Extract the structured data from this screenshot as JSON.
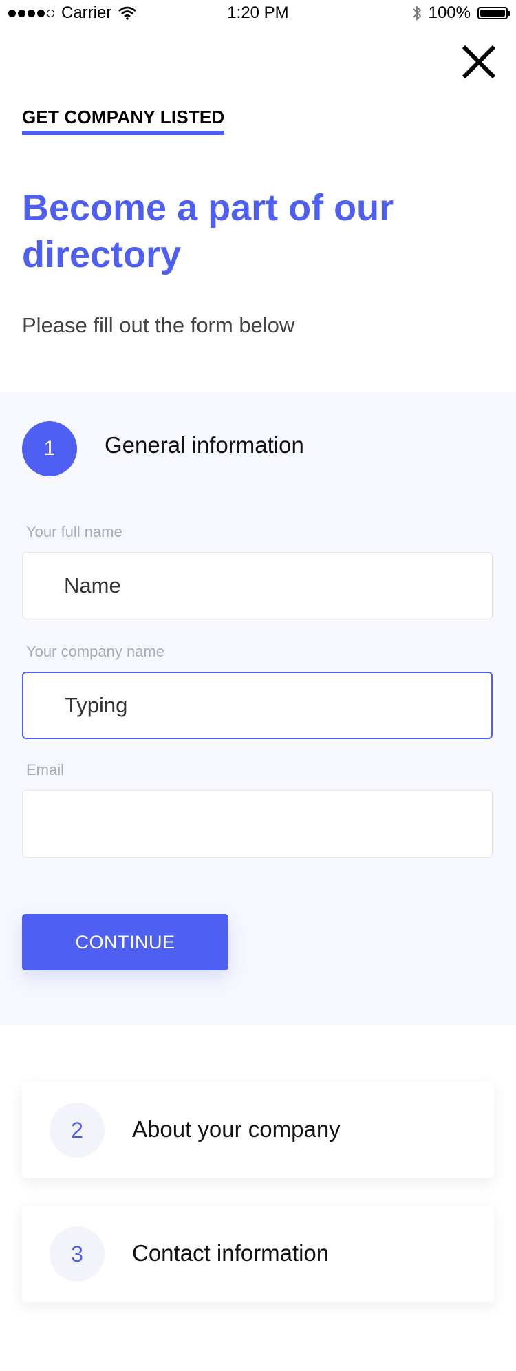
{
  "status_bar": {
    "carrier": "Carrier",
    "time": "1:20 PM",
    "battery": "100%"
  },
  "header": {
    "eyebrow": "GET COMPANY LISTED",
    "headline": "Become a part of our directory",
    "subhead": "Please fill out the form below"
  },
  "steps": {
    "active": {
      "number": "1",
      "title": "General information",
      "fields": [
        {
          "label": "Your full name",
          "value": "Name",
          "placeholder": ""
        },
        {
          "label": "Your company name",
          "value": "Typing",
          "placeholder": ""
        },
        {
          "label": "Email",
          "value": "",
          "placeholder": ""
        }
      ],
      "continue_label": "CONTINUE"
    },
    "collapsed": [
      {
        "number": "2",
        "title": "About your company"
      },
      {
        "number": "3",
        "title": "Contact information"
      }
    ]
  },
  "colors": {
    "accent": "#4f5ff1",
    "section_bg": "#f7f8fd"
  }
}
